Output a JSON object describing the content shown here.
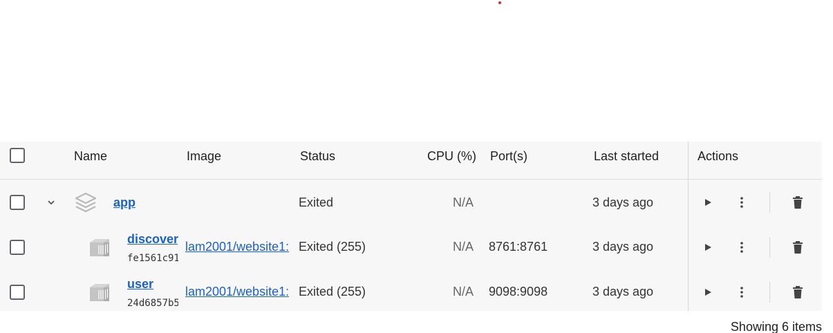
{
  "colors": {
    "link": "#1a62c9",
    "accent_dot": "#d32f2f",
    "table_bg": "#f7f7f7"
  },
  "columns": {
    "name": "Name",
    "image": "Image",
    "status": "Status",
    "cpu": "CPU (%)",
    "ports": "Port(s)",
    "last_started": "Last started",
    "actions": "Actions"
  },
  "rows": [
    {
      "name": "app",
      "image": "",
      "status": "Exited",
      "cpu": "N/A",
      "ports": "",
      "last_started": "3 days ago",
      "icon": "stack-icon",
      "expander": "chevron-down-icon"
    },
    {
      "name": "discovery",
      "id": "fe1561c91",
      "image": "lam2001/website1:",
      "status": "Exited (255)",
      "cpu": "N/A",
      "ports": "8761:8761",
      "last_started": "3 days ago",
      "icon": "container-icon"
    },
    {
      "name": "user",
      "id": "24d6857b5",
      "image": "lam2001/website1:",
      "status": "Exited (255)",
      "cpu": "N/A",
      "ports": "9098:9098",
      "last_started": "3 days ago",
      "icon": "container-icon"
    }
  ],
  "footer": {
    "summary": "Showing 6 items"
  }
}
